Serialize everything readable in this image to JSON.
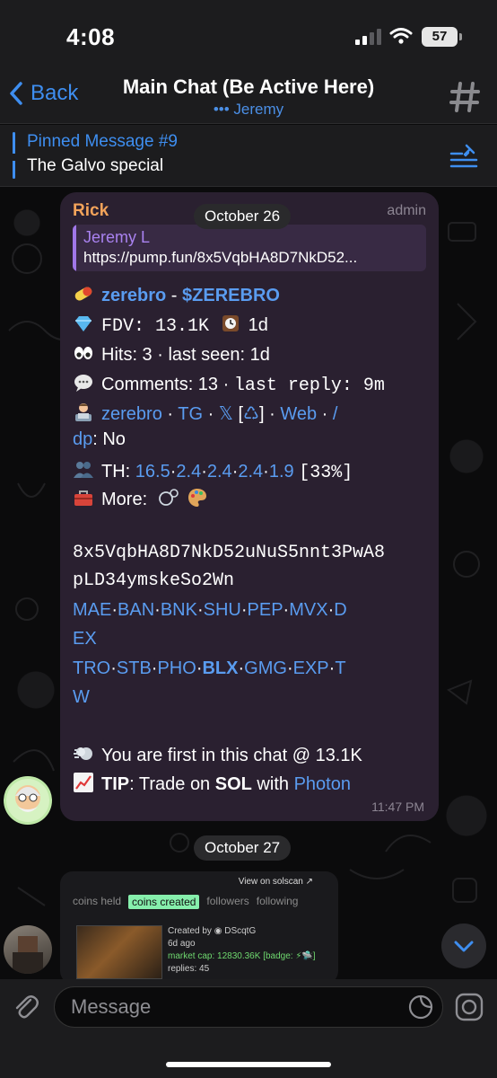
{
  "status_bar": {
    "time": "4:08",
    "battery": "57"
  },
  "header": {
    "back_label": "Back",
    "title": "Main Chat (Be Active Here)",
    "subtitle": "••• Jeremy",
    "icon": "hash-icon"
  },
  "pinned": {
    "title": "Pinned Message #9",
    "text": "The Galvo special"
  },
  "message1": {
    "sender": "Rick",
    "role": "admin",
    "date": "October 26",
    "reply": {
      "name": "Jeremy L",
      "text": "https://pump.fun/8x5VqbHA8D7NkD52..."
    },
    "token_name": "zerebro",
    "token_sep": " - ",
    "ticker": "$ZEREBRO",
    "fdv": "FDV: 13.1K",
    "age": "1d",
    "hits_a": "Hits: 3",
    "hits_b": "last seen: 1d",
    "comments_a": "Comments: 13",
    "comments_b": "last reply: 9m",
    "links": {
      "a": "zerebro",
      "b": "TG",
      "c": "𝕏",
      "d": "Web",
      "e": "/"
    },
    "dp_link": "dp",
    "dp_value": ": No",
    "th_label": "TH:",
    "th_values": [
      "16.5",
      "2.4",
      "2.4",
      "2.4",
      "1.9"
    ],
    "th_pct": "[33%]",
    "more_label": "More:",
    "address_1": "8x5VqbHA8D7NkD52uNuS5nnt3PwA8",
    "address_2": "pLD34ymskeSo2Wn",
    "dex_row1": [
      "MAE",
      "BAN",
      "BNK",
      "SHU",
      "PEP",
      "MVX",
      "D"
    ],
    "dex_row1b": "EX",
    "dex_row2": [
      "TRO",
      "STB",
      "PHO",
      "BLX",
      "GMG",
      "EXP",
      "T"
    ],
    "dex_row2b": "W",
    "first_line": "You are first in this chat @ 13.1K",
    "tip_label": "TIP",
    "tip_mid": ": Trade on ",
    "tip_sol": "SOL",
    "tip_with": " with ",
    "tip_photon": "Photon",
    "time": "11:47 PM"
  },
  "message2": {
    "date": "October 27",
    "view_on": "View on solscan ↗",
    "tabs": [
      "coins held",
      "coins created",
      "followers",
      "following"
    ],
    "created_by": "Created by",
    "creator": "DScqtG",
    "ago": "6d ago",
    "mcap": "market cap: 12830.36K",
    "badge": "[badge: ⚡🛸]",
    "replies": "replies: 45"
  },
  "composer": {
    "placeholder": "Message"
  },
  "colors": {
    "accent": "#3e8ef0",
    "bubble": "#2a2030",
    "sender": "#f3a35a",
    "reply": "#a982f0"
  }
}
